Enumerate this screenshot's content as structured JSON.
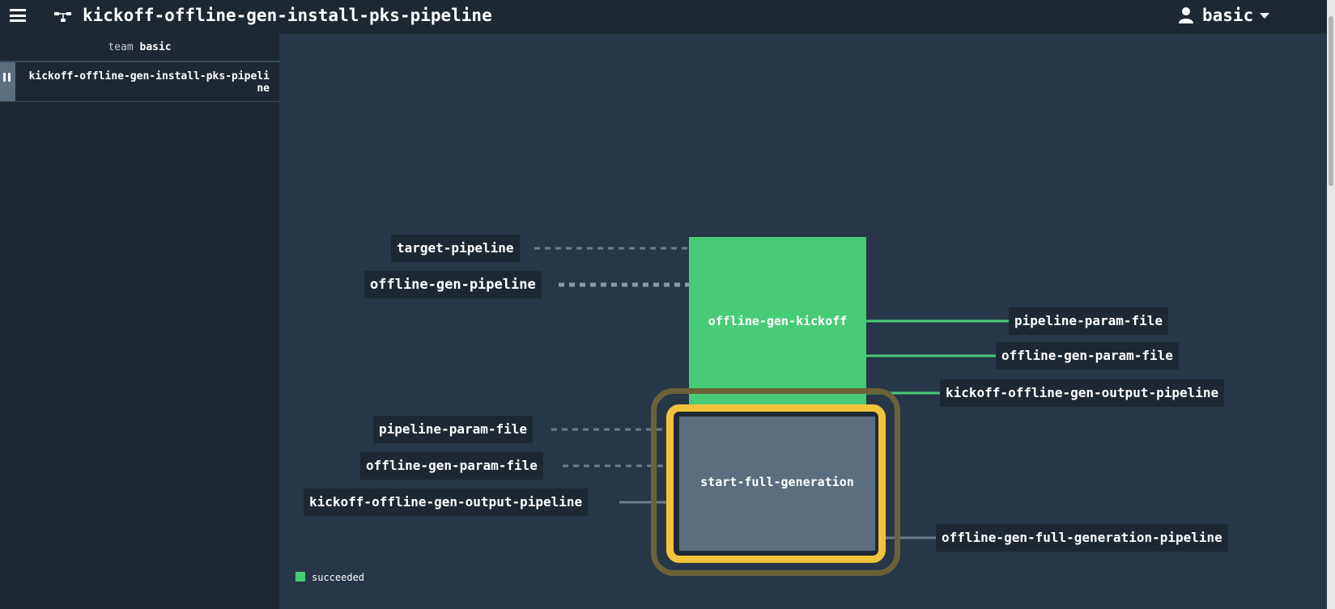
{
  "header": {
    "menu_icon": "hamburger-icon",
    "pipeline_icon": "pipeline-icon",
    "title": "kickoff-offline-gen-install-pks-pipeline",
    "user_icon": "user-icon",
    "user": "basic"
  },
  "sidebar": {
    "team_prefix": "team",
    "team_name": "basic",
    "pipelines": [
      {
        "name": "kickoff-offline-gen-install-pks-pipeline",
        "paused_icon": "pause-icon"
      }
    ]
  },
  "graph": {
    "jobs": {
      "kickoff": {
        "name": "offline-gen-kickoff",
        "status": "succeeded"
      },
      "full": {
        "name": "start-full-generation",
        "status": "pending"
      }
    },
    "inputs_kickoff": [
      "target-pipeline",
      "offline-gen-pipeline"
    ],
    "outputs_kickoff": [
      "pipeline-param-file",
      "offline-gen-param-file",
      "kickoff-offline-gen-output-pipeline"
    ],
    "inputs_full": [
      "pipeline-param-file",
      "offline-gen-param-file",
      "kickoff-offline-gen-output-pipeline"
    ],
    "outputs_full": [
      "offline-gen-full-generation-pipeline"
    ]
  },
  "legend": {
    "label": "succeeded"
  },
  "colors": {
    "succeeded": "#48cb77",
    "pending": "#5b6d7e",
    "running_ring": "#f2c33a",
    "background": "#273747",
    "panel": "#1e2832"
  }
}
